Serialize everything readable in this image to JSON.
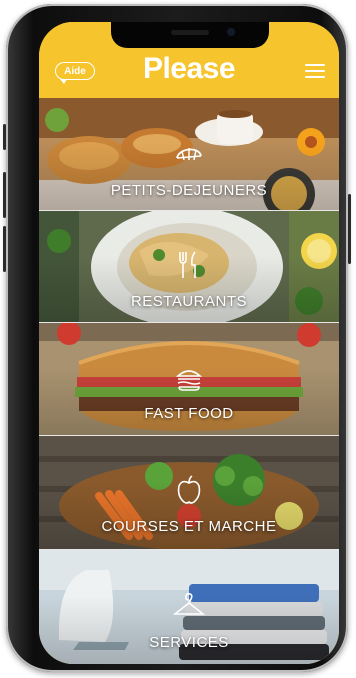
{
  "header": {
    "help_label": "Aide",
    "title": "Please",
    "menu_icon": "hamburger-menu-icon",
    "brand_color": "#f6c52e"
  },
  "categories": [
    {
      "label": "PETITS-DEJEUNERS",
      "icon": "croissant-icon"
    },
    {
      "label": "RESTAURANTS",
      "icon": "fork-knife-icon"
    },
    {
      "label": "FAST FOOD",
      "icon": "burger-icon"
    },
    {
      "label": "COURSES ET MARCHE",
      "icon": "apple-icon"
    },
    {
      "label": "SERVICES",
      "icon": "hanger-icon"
    }
  ]
}
